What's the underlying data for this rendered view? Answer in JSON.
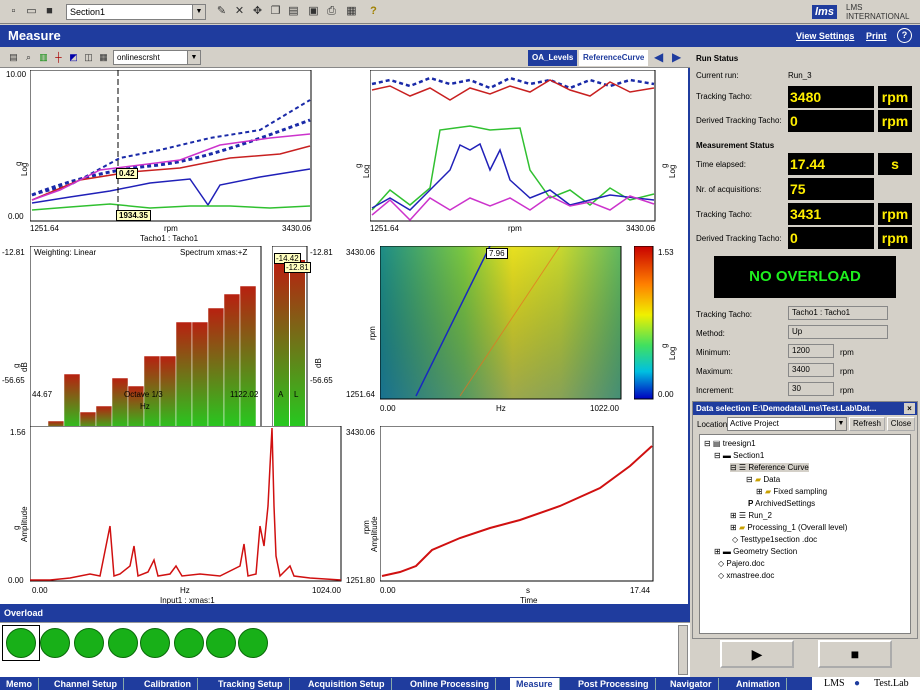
{
  "toolbar": {
    "section_value": "Section1"
  },
  "brand": {
    "logo": "lms",
    "line1": "LMS",
    "line2": "INTERNATIONAL"
  },
  "header": {
    "title": "Measure",
    "view_settings": "View Settings",
    "print": "Print",
    "help": "?"
  },
  "subtoolbar": {
    "display_select": "onlinescrsht",
    "tabs": [
      "OA_Levels",
      "ReferenceCurve"
    ]
  },
  "plots": {
    "p1": {
      "ylabel": "g",
      "yscale": "Log",
      "ymax": "10.00",
      "ymin": "0.00",
      "xmin": "1251.64",
      "xmax": "3430.06",
      "xunit": "rpm",
      "xlabel": "Tacho1 : Tacho1",
      "cursor_y": "0.42",
      "cursor_x": "1934.35"
    },
    "p2": {
      "ylabel": "g",
      "yscale": "Log",
      "xmin": "1251.64",
      "xmax": "3430.06",
      "xunit": "rpm"
    },
    "p3": {
      "ymin_top": "-12.81",
      "ymax_bot": "-56.65",
      "ylabel": "g",
      "yunit": "dB",
      "xmin": "44.67",
      "xmax": "1122.02",
      "xunit": "Hz",
      "xlabel": "Octave 1/3",
      "weighting": "Weighting: Linear",
      "spectrum": "Spectrum xmas:+Z",
      "small_top": "-12.81",
      "small_bot": "-56.65",
      "small_unit": "dB",
      "small_ylabel": "g",
      "val1": "-14.42",
      "val2": "-12.81",
      "small_x1": "A",
      "small_x2": "L"
    },
    "p4": {
      "ymax": "3430.06",
      "ymin": "1251.64",
      "yunit": "rpm",
      "xmin": "0.00",
      "xmax": "1022.00",
      "xunit": "Hz",
      "marker": "7.96",
      "cbar_max": "1.53",
      "cbar_min": "0.00",
      "cbar_unit": "g",
      "cbar_scale": "Log"
    },
    "p5": {
      "ymax": "1.56",
      "ymin": "0.00",
      "ylabel": "g",
      "yunit": "Amplitude",
      "xmin": "0.00",
      "xmax": "1024.00",
      "xunit": "Hz",
      "xlabel": "Input1 : xmas:1"
    },
    "p6": {
      "ymax": "3430.06",
      "ymin": "1251.80",
      "ylabel": "rpm",
      "yunit": "Amplitude",
      "xmin": "0.00",
      "xmax": "17.44",
      "xunit": "s",
      "xlabel": "Time"
    }
  },
  "overload": {
    "title": "Overload",
    "leds": 8
  },
  "run_status": {
    "title": "Run Status",
    "current_run_label": "Current run:",
    "current_run": "Run_3",
    "tracking_tacho_label": "Tracking Tacho:",
    "tracking_tacho": "3480",
    "tracking_unit": "rpm",
    "derived_label": "Derived Tracking Tacho:",
    "derived": "0",
    "derived_unit": "rpm"
  },
  "measurement_status": {
    "title": "Measurement Status",
    "time_label": "Time elapsed:",
    "time": "17.44",
    "time_unit": "s",
    "acq_label": "Nr. of acquisitions:",
    "acq": "75",
    "tracking_label": "Tracking Tacho:",
    "tracking": "3431",
    "tracking_unit": "rpm",
    "derived_label": "Derived Tracking Tacho:",
    "derived": "0",
    "derived_unit": "rpm"
  },
  "no_overload": "NO OVERLOAD",
  "settings": {
    "tacho_label": "Tracking Tacho:",
    "tacho": "Tacho1 : Tacho1",
    "method_label": "Method:",
    "method": "Up",
    "min_label": "Minimum:",
    "min": "1200",
    "min_unit": "rpm",
    "max_label": "Maximum:",
    "max": "3400",
    "max_unit": "rpm",
    "inc_label": "Increment:",
    "inc": "30",
    "inc_unit": "rpm"
  },
  "data_selection": {
    "title": "Data selection E:\\Demodata\\Lms\\Test.Lab\\Dat...",
    "location_label": "Location",
    "location": "Active Project",
    "refresh": "Refresh",
    "close": "Close",
    "tree": [
      "treesign1",
      "Section1",
      "Reference Curve",
      "Data",
      "Fixed sampling",
      "ArchivedSettings",
      "Run_2",
      "Processing_1 (Overall level)",
      "Testtype1section .doc",
      "Geometry Section",
      "Pajero.doc",
      "xmastree.doc"
    ]
  },
  "bottom_tabs": [
    "Memo",
    "Channel Setup",
    "Calibration",
    "Tracking Setup",
    "Acquisition Setup",
    "Online Processing",
    "Measure",
    "Post Processing",
    "Navigator",
    "Animation"
  ],
  "bottom_active": "Measure",
  "footer_brand": {
    "lms": "LMS",
    "product": "Test.Lab"
  }
}
